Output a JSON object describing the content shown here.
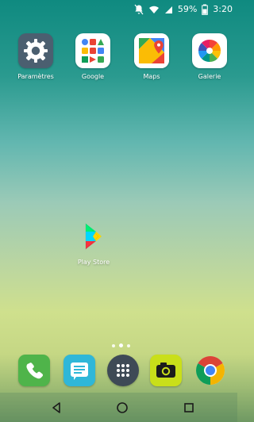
{
  "status_bar": {
    "battery_percent_text": "59%",
    "time": "3:20",
    "icons": [
      "notifications-off-icon",
      "wifi-icon",
      "cell-signal-icon",
      "battery-icon"
    ]
  },
  "home_apps": [
    {
      "label": "Paramètres",
      "icon": "settings-gear-icon"
    },
    {
      "label": "Google",
      "icon": "google-apps-folder-icon"
    },
    {
      "label": "Maps",
      "icon": "google-maps-icon"
    },
    {
      "label": "Galerie",
      "icon": "gallery-pinwheel-icon"
    }
  ],
  "play_store": {
    "label": "Play Store",
    "icon": "play-store-icon"
  },
  "page_indicator": {
    "pages": 3,
    "active_index": 1
  },
  "dock": [
    {
      "icon": "phone-icon"
    },
    {
      "icon": "messages-icon"
    },
    {
      "icon": "app-drawer-icon"
    },
    {
      "icon": "camera-icon"
    },
    {
      "icon": "chrome-icon"
    }
  ],
  "nav_bar": {
    "buttons": [
      "back-icon",
      "home-icon",
      "recents-icon"
    ]
  },
  "colors": {
    "wallpaper_top": "#0f8a80",
    "wallpaper_bottom": "#6f9963",
    "settings_bg": "#4b5f70",
    "phone_bg": "#4fb44a",
    "messages_bg": "#2fb7d8",
    "camera_bg": "#c9df1a"
  }
}
